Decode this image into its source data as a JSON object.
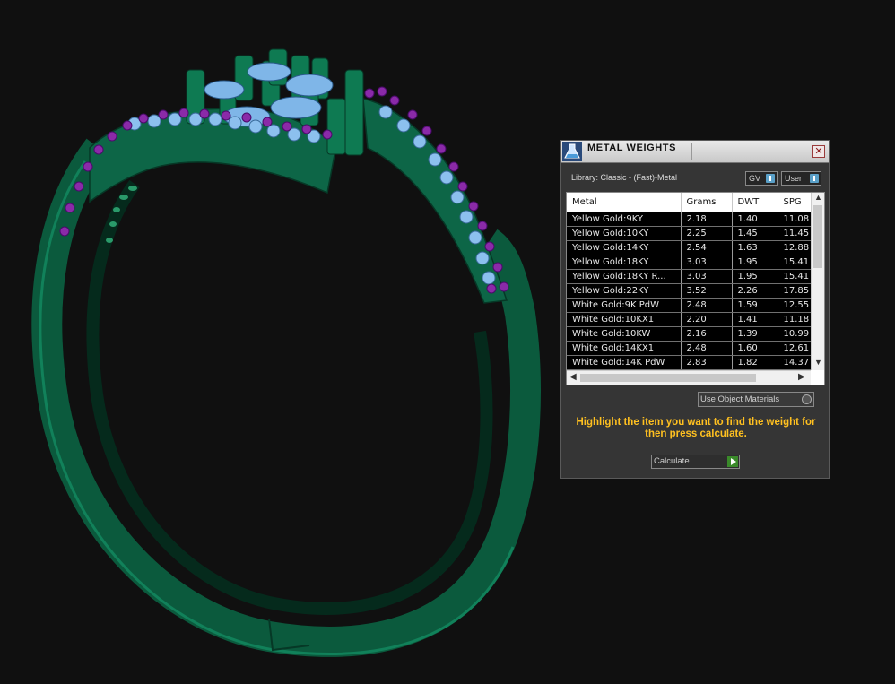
{
  "viewport": {
    "colors": {
      "metal": "#0e6a4a",
      "metal_dark": "#063826",
      "stone": "#7fb6e8",
      "accent_stone": "#8a2aa8"
    }
  },
  "panel": {
    "title": "METAL WEIGHTS",
    "close_label": "✕",
    "library_label": "Library: Classic - (Fast)-Metal",
    "toggle_gv": "GV",
    "toggle_user": "User",
    "columns": [
      "Metal",
      "Grams",
      "DWT",
      "SPG"
    ],
    "rows": [
      {
        "metal": "Yellow Gold:9KY",
        "grams": "2.18",
        "dwt": "1.40",
        "spg": "11.08"
      },
      {
        "metal": "Yellow Gold:10KY",
        "grams": "2.25",
        "dwt": "1.45",
        "spg": "11.45"
      },
      {
        "metal": "Yellow Gold:14KY",
        "grams": "2.54",
        "dwt": "1.63",
        "spg": "12.88"
      },
      {
        "metal": "Yellow Gold:18KY",
        "grams": "3.03",
        "dwt": "1.95",
        "spg": "15.41"
      },
      {
        "metal": "Yellow Gold:18KY R...",
        "grams": "3.03",
        "dwt": "1.95",
        "spg": "15.41"
      },
      {
        "metal": "Yellow Gold:22KY",
        "grams": "3.52",
        "dwt": "2.26",
        "spg": "17.85"
      },
      {
        "metal": "White Gold:9K PdW",
        "grams": "2.48",
        "dwt": "1.59",
        "spg": "12.55"
      },
      {
        "metal": "White Gold:10KX1",
        "grams": "2.20",
        "dwt": "1.41",
        "spg": "11.18"
      },
      {
        "metal": "White Gold:10KW",
        "grams": "2.16",
        "dwt": "1.39",
        "spg": "10.99"
      },
      {
        "metal": "White Gold:14KX1",
        "grams": "2.48",
        "dwt": "1.60",
        "spg": "12.61"
      },
      {
        "metal": "White Gold:14K PdW",
        "grams": "2.83",
        "dwt": "1.82",
        "spg": "14.37"
      }
    ],
    "use_object_materials": "Use Object Materials",
    "instructions": "Highlight the item you want to find the weight for then press calculate.",
    "calculate_label": "Calculate"
  }
}
